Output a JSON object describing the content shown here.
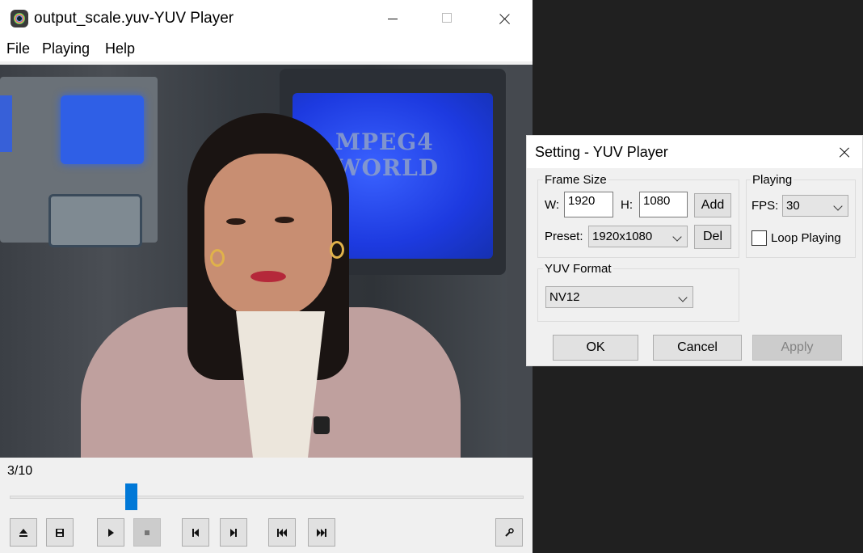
{
  "player": {
    "title": "output_scale.yuv-YUV Player",
    "menu": [
      "File",
      "Playing",
      "Help"
    ],
    "video_text": [
      "MPEG4",
      "WORLD"
    ],
    "frame_counter": "3/10",
    "seek": {
      "current_frame": 3,
      "total_frames": 10,
      "fraction": 0.23
    },
    "toolbar_icons": [
      "eject-icon",
      "save-icon",
      "play-icon",
      "stop-icon",
      "prev-frame-icon",
      "next-frame-icon",
      "first-frame-icon",
      "last-frame-icon",
      "settings-wrench-icon"
    ]
  },
  "settings": {
    "title": "Setting - YUV Player",
    "frame_size": {
      "group_label": "Frame Size",
      "w_label": "W:",
      "w_value": "1920",
      "h_label": "H:",
      "h_value": "1080",
      "add_label": "Add",
      "preset_label": "Preset:",
      "preset_value": "1920x1080",
      "del_label": "Del"
    },
    "playing": {
      "group_label": "Playing",
      "fps_label": "FPS:",
      "fps_value": "30",
      "loop_label": "Loop Playing",
      "loop_checked": false
    },
    "yuv_format": {
      "group_label": "YUV Format",
      "value": "NV12"
    },
    "buttons": {
      "ok": "OK",
      "cancel": "Cancel",
      "apply": "Apply"
    }
  },
  "colors": {
    "accent": "#0078d7",
    "window_bg": "#f0f0f0",
    "desktop": "#202020"
  }
}
